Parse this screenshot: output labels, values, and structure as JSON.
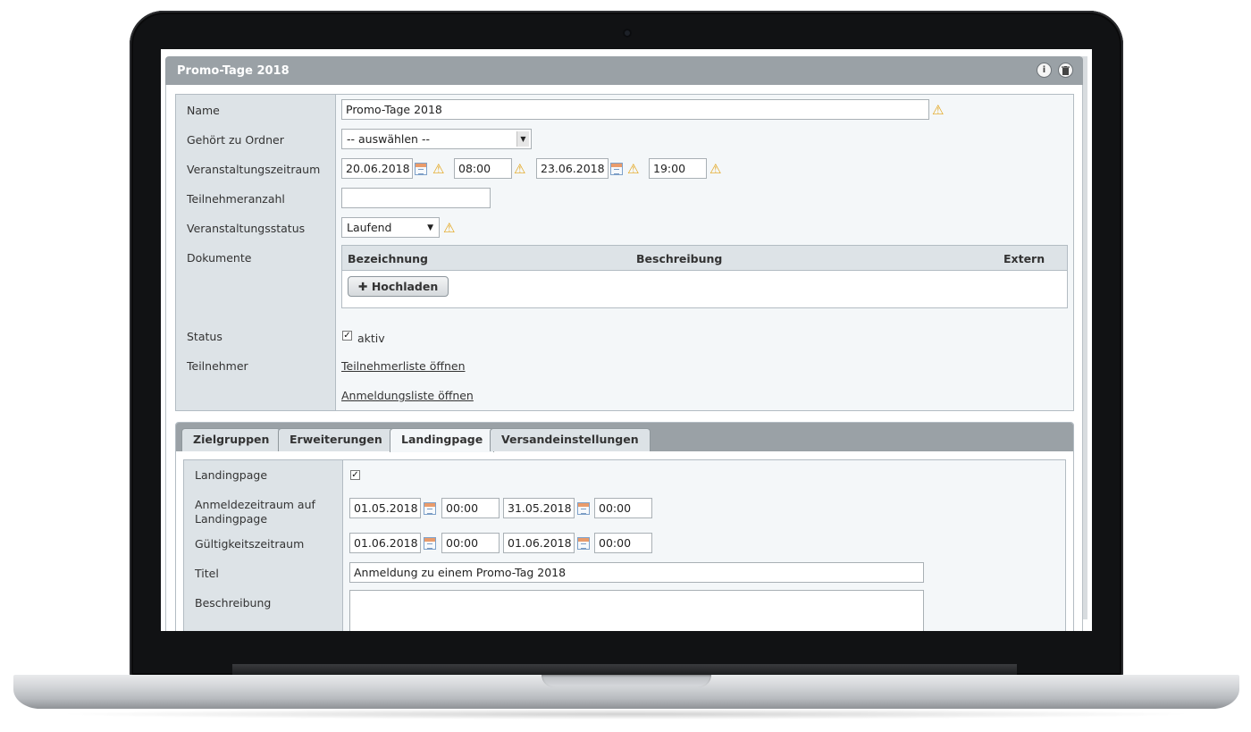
{
  "panel": {
    "title": "Promo-Tage 2018",
    "info_icon": "info-circle-icon",
    "delete_icon": "trash-icon"
  },
  "form": {
    "name": {
      "label": "Name",
      "value": "Promo-Tage 2018"
    },
    "folder": {
      "label": "Gehört zu Ordner",
      "value": "-- auswählen --"
    },
    "period": {
      "label": "Veranstaltungszeitraum",
      "start_date": "20.06.2018",
      "start_time": "08:00",
      "end_date": "23.06.2018",
      "end_time": "19:00"
    },
    "participants_count": {
      "label": "Teilnehmeranzahl",
      "value": ""
    },
    "event_status": {
      "label": "Veranstaltungsstatus",
      "value": "Laufend"
    },
    "documents": {
      "label": "Dokumente",
      "columns": [
        "Bezeichnung",
        "Beschreibung",
        "Extern"
      ],
      "upload_label": "Hochladen"
    },
    "status": {
      "label": "Status",
      "checkbox_label": "aktiv",
      "checked": true
    },
    "participants": {
      "label": "Teilnehmer",
      "list_link": "Teilnehmerliste öffnen",
      "registration_link": "Anmeldungsliste öffnen"
    }
  },
  "tabs": [
    "Zielgruppen",
    "Erweiterungen",
    "Landingpage",
    "Versandeinstellungen"
  ],
  "active_tab": "Landingpage",
  "landing": {
    "landingpage": {
      "label": "Landingpage",
      "checked": true
    },
    "registration_period": {
      "label": "Anmeldezeitraum auf Landingpage",
      "start_date": "01.05.2018",
      "start_time": "00:00",
      "end_date": "31.05.2018",
      "end_time": "00:00"
    },
    "validity_period": {
      "label": "Gültigkeitszeitraum",
      "start_date": "01.06.2018",
      "start_time": "00:00",
      "end_date": "01.06.2018",
      "end_time": "00:00"
    },
    "title": {
      "label": "Titel",
      "value": "Anmeldung zu einem Promo-Tag 2018"
    },
    "description": {
      "label": "Beschreibung",
      "value": ""
    }
  },
  "colors": {
    "header_bg": "#9aa1a6",
    "label_bg": "#dde3e7",
    "warning": "#e3a51b"
  }
}
